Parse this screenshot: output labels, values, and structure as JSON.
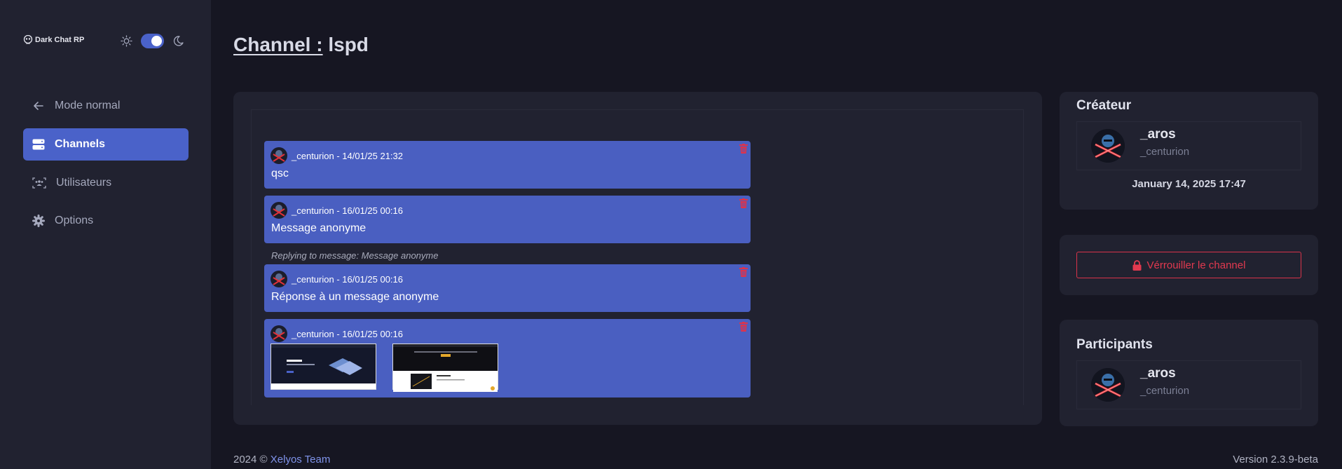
{
  "brand": {
    "name": "Dark Chat RP"
  },
  "theme": {
    "mode": "dark"
  },
  "sidebar": {
    "items": [
      {
        "label": "Mode normal",
        "icon": "arrow-left-icon"
      },
      {
        "label": "Channels",
        "icon": "server-icon",
        "active": true
      },
      {
        "label": "Utilisateurs",
        "icon": "users-icon"
      },
      {
        "label": "Options",
        "icon": "gear-icon"
      }
    ]
  },
  "page": {
    "title_label": "Channel :",
    "channel_name": "lspd"
  },
  "messages": [
    {
      "author": "_centurion",
      "date": "14/01/25 21:32",
      "header": "_centurion - 14/01/25 21:32",
      "text": "qsc"
    },
    {
      "author": "_centurion",
      "date": "16/01/25 00:16",
      "header": "_centurion - 16/01/25 00:16",
      "text": "Message anonyme"
    },
    {
      "reply_to": "Replying to message: Message anonyme",
      "author": "_centurion",
      "date": "16/01/25 00:16",
      "header": "_centurion - 16/01/25 00:16",
      "text": "Réponse à un message anonyme"
    },
    {
      "author": "_centurion",
      "date": "16/01/25 00:16",
      "header": "_centurion - 16/01/25 00:16",
      "text": "",
      "attachments": 2
    }
  ],
  "creator": {
    "title": "Créateur",
    "name": "_aros",
    "handle": "_centurion",
    "date": "January 14, 2025 17:47"
  },
  "lock": {
    "label": "Vérrouiller le channel"
  },
  "participants": {
    "title": "Participants",
    "items": [
      {
        "name": "_aros",
        "handle": "_centurion"
      }
    ]
  },
  "footer": {
    "copyright": "2024 ©",
    "team": "Xelyos Team",
    "version": "Version 2.3.9-beta"
  },
  "colors": {
    "accent": "#4a62c9",
    "message_bg": "#4a5fc1",
    "danger": "#e2394f",
    "panel": "#212230",
    "background": "#161622"
  }
}
